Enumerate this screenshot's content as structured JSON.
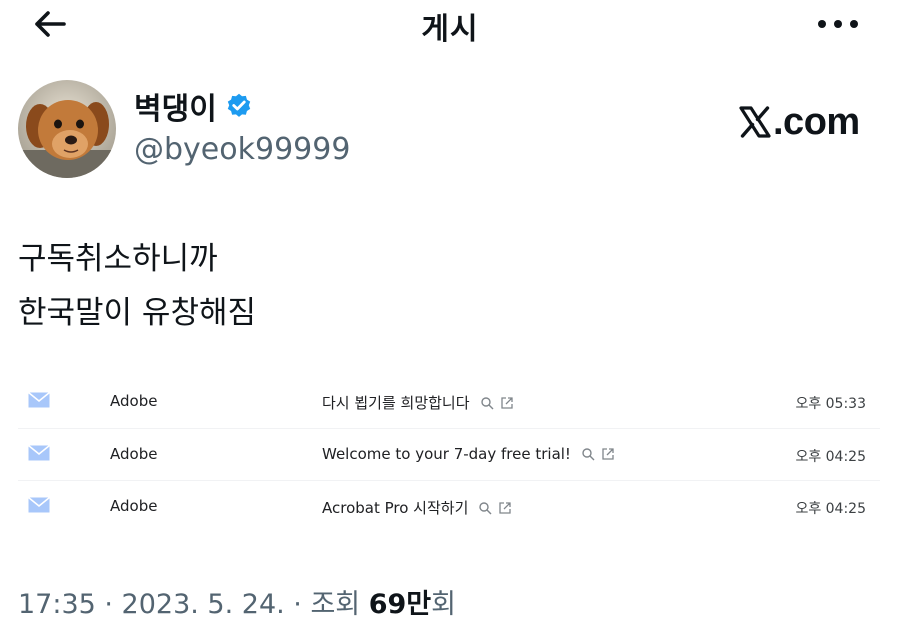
{
  "header": {
    "title": "게시",
    "back_icon": "arrow-left-icon",
    "more_icon": "more-horizontal-icon"
  },
  "author": {
    "name": "벽댕이",
    "handle": "@byeok99999",
    "verified_color": "#1d9bf0",
    "avatar_icon": "dog-avatar"
  },
  "watermark": {
    "text": ".com",
    "logo_icon": "x-logo-icon"
  },
  "post": {
    "line1": "구독취소하니까",
    "line2": "한국말이 유창해짐"
  },
  "emails": [
    {
      "sender": "Adobe",
      "subject": "다시 뵙기를 희망합니다",
      "time": "오후 05:33"
    },
    {
      "sender": "Adobe",
      "subject": "Welcome to your 7-day free trial!",
      "time": "오후 04:25"
    },
    {
      "sender": "Adobe",
      "subject": "Acrobat Pro 시작하기",
      "time": "오후 04:25"
    }
  ],
  "meta": {
    "timestamp": "17:35 · 2023. 5. 24. · 조회 ",
    "views": "69만",
    "views_suffix": "회"
  },
  "colors": {
    "text": "#0f1419",
    "secondary": "#536471",
    "mail_icon": "#a8c7fa"
  }
}
